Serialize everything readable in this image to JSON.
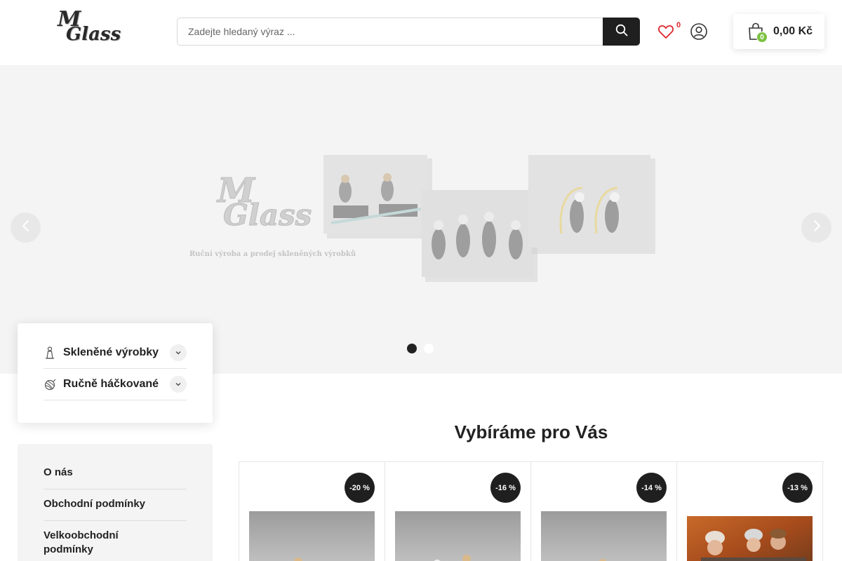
{
  "header": {
    "logo": {
      "line1": "M",
      "line2": "Glass"
    },
    "search_placeholder": "Zadejte hledaný výraz ...",
    "wishlist_count": "0",
    "cart": {
      "count": "0",
      "total": "0,00 Kč"
    },
    "icons": {
      "search": "search-icon",
      "wishlist": "heart-icon",
      "account": "user-icon",
      "cart": "shopping-bag-icon"
    }
  },
  "slider": {
    "logo": {
      "line1": "M",
      "line2": "Glass"
    },
    "caption": "Ruční výroba a prodej skleněných výrobků",
    "slides": 2,
    "active_slide": 1
  },
  "categories": [
    {
      "label": "Skleněné výrobky",
      "icon": "glass-figure-icon"
    },
    {
      "label": "Ručně háčkované",
      "icon": "yarn-ball-icon"
    }
  ],
  "info_links": [
    {
      "label": "O nás"
    },
    {
      "label": "Obchodní podmínky"
    },
    {
      "label": "Velkoobchodní podmínky"
    }
  ],
  "section": {
    "title": "Vybíráme pro Vás"
  },
  "products": [
    {
      "discount": "-20 %"
    },
    {
      "discount": "-16 %"
    },
    {
      "discount": "-14 %"
    },
    {
      "discount": "-13 %"
    }
  ],
  "colors": {
    "accent_dark": "#1f1f1f",
    "cart_badge": "#7cc242",
    "wishlist_count": "#e0252b",
    "slider_bg": "#f4f4f4"
  }
}
